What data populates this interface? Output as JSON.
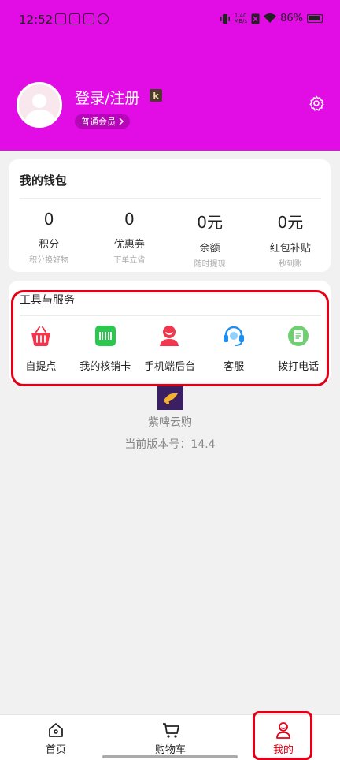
{
  "status_bar": {
    "time": "12:52",
    "speed_value": "1.40",
    "speed_unit": "MB/s",
    "battery": "86%"
  },
  "profile": {
    "login_text": "登录/注册",
    "badge_letter": "k",
    "member_level": "普通会员",
    "settings_icon": "gear-icon"
  },
  "wallet": {
    "title": "我的钱包",
    "items": [
      {
        "value": "0",
        "label": "积分",
        "sub": "积分换好物"
      },
      {
        "value": "0",
        "label": "优惠券",
        "sub": "下单立省"
      },
      {
        "value": "0元",
        "label": "余额",
        "sub": "随时提现"
      },
      {
        "value": "0元",
        "label": "红包补贴",
        "sub": "秒到账"
      }
    ]
  },
  "services": {
    "title": "工具与服务",
    "items": [
      {
        "label": "自提点",
        "icon": "basket-icon"
      },
      {
        "label": "我的核销卡",
        "icon": "card-icon"
      },
      {
        "label": "手机端后台",
        "icon": "user-icon"
      },
      {
        "label": "客服",
        "icon": "headset-icon"
      },
      {
        "label": "拨打电话",
        "icon": "phone-note-icon"
      }
    ]
  },
  "app_info": {
    "name": "紫啤云购",
    "version": "当前版本号：14.4"
  },
  "tabbar": {
    "items": [
      {
        "label": "首页",
        "icon": "home-icon",
        "active": false
      },
      {
        "label": "购物车",
        "icon": "cart-icon",
        "active": false
      },
      {
        "label": "我的",
        "icon": "profile-icon",
        "active": true
      }
    ]
  },
  "colors": {
    "header": "#e10de4",
    "accent_red": "#e30016",
    "page_bg": "#f1f1f1"
  }
}
